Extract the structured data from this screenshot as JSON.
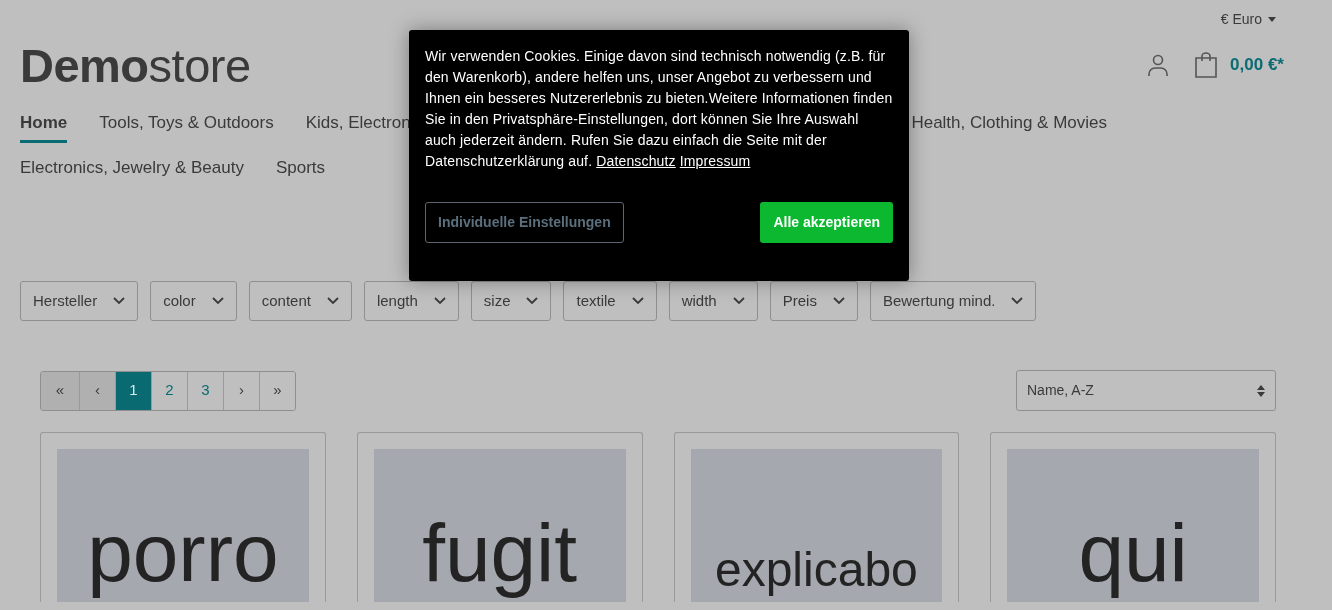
{
  "currency": {
    "label": "€ Euro"
  },
  "logo": {
    "bold": "Demo",
    "light": "store"
  },
  "cart": {
    "total": "0,00 €*"
  },
  "nav_rows": [
    {
      "items": [
        {
          "label": "Home",
          "selected": true
        },
        {
          "label": "Tools, Toys & Outdoors",
          "selected": false
        },
        {
          "label": "Kids, Electron",
          "selected": false
        },
        {
          "label": "Health, Clothing & Movies",
          "selected": false
        }
      ]
    },
    {
      "items": [
        {
          "label": "Electronics, Jewelry & Beauty",
          "selected": false
        },
        {
          "label": "Sports",
          "selected": false
        }
      ]
    }
  ],
  "cookie_banner": {
    "text": "Wir verwenden Cookies. Einige davon sind technisch notwendig (z.B. für den Warenkorb), andere helfen uns, unser Angebot zu verbessern und Ihnen ein besseres Nutzererlebnis zu bieten.Weitere Informationen finden Sie in den Privatsphäre-Einstellungen, dort können Sie Ihre Auswahl auch jederzeit ändern. Rufen Sie dazu einfach die Seite mit der Datenschutzerklärung auf.",
    "links": [
      "Datenschutz",
      "Impressum"
    ],
    "settings_button": "Individuelle Einstellungen",
    "accept_button": "Alle akzeptieren"
  },
  "filters": [
    "Hersteller",
    "color",
    "content",
    "length",
    "size",
    "textile",
    "width",
    "Preis",
    "Bewertung mind."
  ],
  "pagination": [
    {
      "label": "«",
      "selected": false,
      "disabled": true
    },
    {
      "label": "‹",
      "selected": false,
      "disabled": true
    },
    {
      "label": "1",
      "selected": true,
      "disabled": false
    },
    {
      "label": "2",
      "selected": false,
      "disabled": false
    },
    {
      "label": "3",
      "selected": false,
      "disabled": false
    },
    {
      "label": "›",
      "selected": false,
      "disabled": false
    },
    {
      "label": "»",
      "selected": false,
      "disabled": false
    }
  ],
  "sort": {
    "value": "Name, A-Z"
  },
  "products": [
    {
      "image_text": "porro"
    },
    {
      "image_text": "fugit"
    },
    {
      "image_text": "explicabo"
    },
    {
      "image_text": "qui"
    }
  ]
}
